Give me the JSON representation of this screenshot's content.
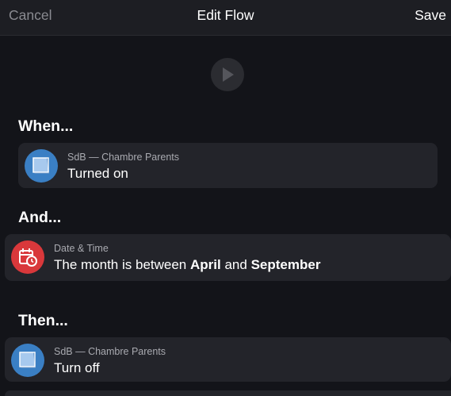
{
  "header": {
    "cancel_label": "Cancel",
    "title": "Edit Flow",
    "save_label": "Save"
  },
  "play_icon": "play-icon",
  "when": {
    "heading": "When...",
    "card": {
      "icon": "window-blinds-icon",
      "icon_color": "#3a7fc4",
      "device": "SdB — Chambre Parents",
      "action": "Turned on"
    }
  },
  "and": {
    "heading": "And...",
    "card": {
      "icon": "calendar-clock-icon",
      "icon_color": "#d9383b",
      "device": "Date & Time",
      "condition_prefix": "The month is between",
      "month_from": "April",
      "joiner": "and",
      "month_to": "September"
    }
  },
  "then": {
    "heading": "Then...",
    "card": {
      "icon": "window-blinds-icon",
      "icon_color": "#3a7fc4",
      "device": "SdB — Chambre Parents",
      "action": "Turn off"
    }
  },
  "colors": {
    "background": "#131419",
    "header": "#1d1e23",
    "card": "#23242a",
    "muted_text": "#8a8b91"
  }
}
